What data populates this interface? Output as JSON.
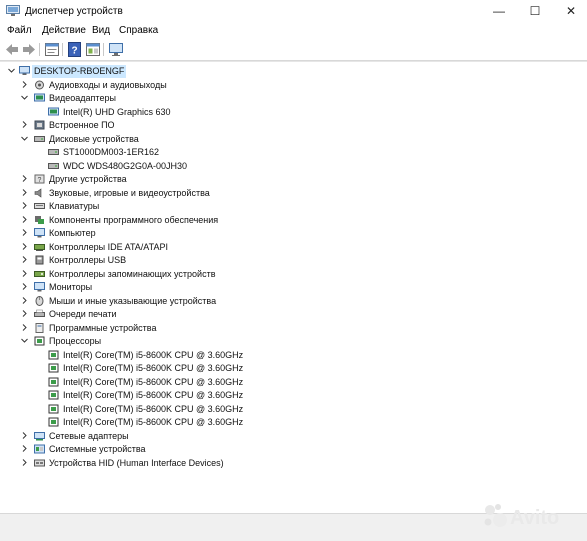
{
  "window": {
    "title": "Диспетчер устройств",
    "minimize": "—",
    "maximize": "☐",
    "close": "✕"
  },
  "menu": {
    "items": [
      "Файл",
      "Действие",
      "Вид",
      "Справка"
    ]
  },
  "toolbar": {
    "buttons": [
      "back-icon",
      "forward-icon",
      "properties-icon",
      "help-icon",
      "update-driver-icon",
      "scan-hardware-icon"
    ]
  },
  "tree": {
    "root": {
      "label": "DESKTOP-RBOENGF",
      "expanded": true,
      "icon": "computer-icon"
    },
    "rows": [
      {
        "label": "Аудиовходы и аудиовыходы",
        "level": 1,
        "expanded": false,
        "icon": "audio-icon"
      },
      {
        "label": "Видеоадаптеры",
        "level": 1,
        "expanded": true,
        "icon": "display-adapter-icon"
      },
      {
        "label": "Intel(R) UHD Graphics 630",
        "level": 2,
        "expanded": null,
        "icon": "display-adapter-icon"
      },
      {
        "label": "Встроенное ПО",
        "level": 1,
        "expanded": false,
        "icon": "firmware-icon"
      },
      {
        "label": "Дисковые устройства",
        "level": 1,
        "expanded": true,
        "icon": "disk-icon"
      },
      {
        "label": "ST1000DM003-1ER162",
        "level": 2,
        "expanded": null,
        "icon": "disk-icon"
      },
      {
        "label": "WDC WDS480G2G0A-00JH30",
        "level": 2,
        "expanded": null,
        "icon": "disk-icon"
      },
      {
        "label": "Другие устройства",
        "level": 1,
        "expanded": false,
        "icon": "other-device-icon"
      },
      {
        "label": "Звуковые, игровые и видеоустройства",
        "level": 1,
        "expanded": false,
        "icon": "speaker-icon"
      },
      {
        "label": "Клавиатуры",
        "level": 1,
        "expanded": false,
        "icon": "keyboard-icon"
      },
      {
        "label": "Компоненты программного обеспечения",
        "level": 1,
        "expanded": false,
        "icon": "software-component-icon"
      },
      {
        "label": "Компьютер",
        "level": 1,
        "expanded": false,
        "icon": "monitor-icon"
      },
      {
        "label": "Контроллеры IDE ATA/ATAPI",
        "level": 1,
        "expanded": false,
        "icon": "ide-controller-icon"
      },
      {
        "label": "Контроллеры USB",
        "level": 1,
        "expanded": false,
        "icon": "usb-icon"
      },
      {
        "label": "Контроллеры запоминающих устройств",
        "level": 1,
        "expanded": false,
        "icon": "storage-controller-icon"
      },
      {
        "label": "Мониторы",
        "level": 1,
        "expanded": false,
        "icon": "monitor-icon"
      },
      {
        "label": "Мыши и иные указывающие устройства",
        "level": 1,
        "expanded": false,
        "icon": "mouse-icon"
      },
      {
        "label": "Очереди печати",
        "level": 1,
        "expanded": false,
        "icon": "printer-icon"
      },
      {
        "label": "Программные устройства",
        "level": 1,
        "expanded": false,
        "icon": "software-device-icon"
      },
      {
        "label": "Процессоры",
        "level": 1,
        "expanded": true,
        "icon": "processor-icon"
      },
      {
        "label": "Intel(R) Core(TM) i5-8600K CPU @ 3.60GHz",
        "level": 2,
        "expanded": null,
        "icon": "processor-icon"
      },
      {
        "label": "Intel(R) Core(TM) i5-8600K CPU @ 3.60GHz",
        "level": 2,
        "expanded": null,
        "icon": "processor-icon"
      },
      {
        "label": "Intel(R) Core(TM) i5-8600K CPU @ 3.60GHz",
        "level": 2,
        "expanded": null,
        "icon": "processor-icon"
      },
      {
        "label": "Intel(R) Core(TM) i5-8600K CPU @ 3.60GHz",
        "level": 2,
        "expanded": null,
        "icon": "processor-icon"
      },
      {
        "label": "Intel(R) Core(TM) i5-8600K CPU @ 3.60GHz",
        "level": 2,
        "expanded": null,
        "icon": "processor-icon"
      },
      {
        "label": "Intel(R) Core(TM) i5-8600K CPU @ 3.60GHz",
        "level": 2,
        "expanded": null,
        "icon": "processor-icon"
      },
      {
        "label": "Сетевые адаптеры",
        "level": 1,
        "expanded": false,
        "icon": "network-adapter-icon"
      },
      {
        "label": "Системные устройства",
        "level": 1,
        "expanded": false,
        "icon": "system-device-icon"
      },
      {
        "label": "Устройства HID (Human Interface Devices)",
        "level": 1,
        "expanded": false,
        "icon": "hid-icon"
      }
    ]
  },
  "watermark": {
    "text": "Avito",
    "icon": "avito-logo-icon"
  }
}
